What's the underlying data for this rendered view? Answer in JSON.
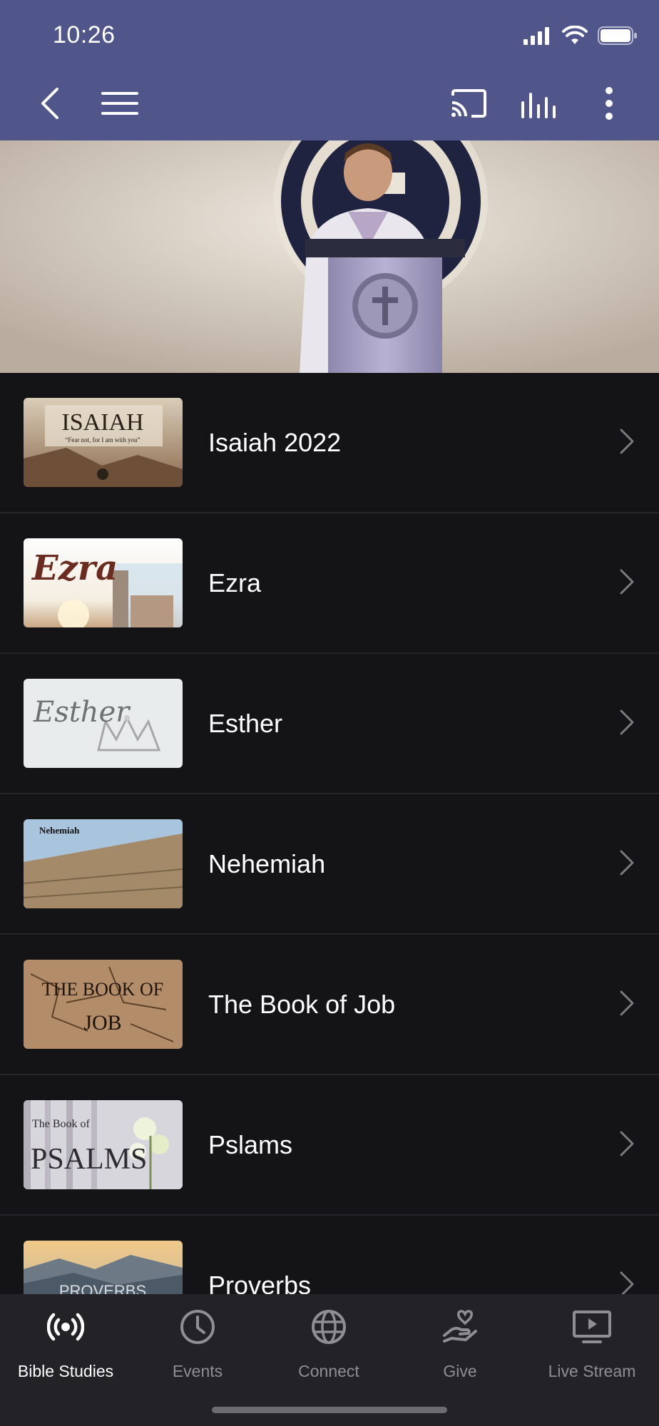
{
  "status_bar": {
    "time": "10:26"
  },
  "nav": {
    "back_icon": "chevron-left-icon",
    "menu_icon": "hamburger-icon",
    "cast_icon": "cast-icon",
    "audio_icon": "equalizer-icon",
    "more_icon": "vertical-dots-icon"
  },
  "hero": {
    "description_icon": "hero-banner-image"
  },
  "series": [
    {
      "title": "Isaiah 2022",
      "thumb_text": "ISAIAH",
      "thumb_subtext": "“Fear not, for I am with you”"
    },
    {
      "title": "Ezra",
      "thumb_text": "Ezra"
    },
    {
      "title": "Esther",
      "thumb_text": "Esther"
    },
    {
      "title": "Nehemiah",
      "thumb_text": "Nehemiah"
    },
    {
      "title": "The Book of Job",
      "thumb_text": "THE BOOK OF JOB"
    },
    {
      "title": "Pslams",
      "thumb_text": "The Book of PSALMS"
    },
    {
      "title": "Proverbs",
      "thumb_text": "PROVERBS"
    }
  ],
  "tabs": [
    {
      "label": "Bible Studies",
      "icon": "broadcast-icon",
      "active": true
    },
    {
      "label": "Events",
      "icon": "clock-icon",
      "active": false
    },
    {
      "label": "Connect",
      "icon": "globe-icon",
      "active": false
    },
    {
      "label": "Give",
      "icon": "heart-hand-icon",
      "active": false
    },
    {
      "label": "Live Stream",
      "icon": "tv-play-icon",
      "active": false
    }
  ],
  "colors": {
    "header": "#50558a",
    "background": "#141416",
    "tabbar": "#232327",
    "inactive": "#8e8e93"
  }
}
